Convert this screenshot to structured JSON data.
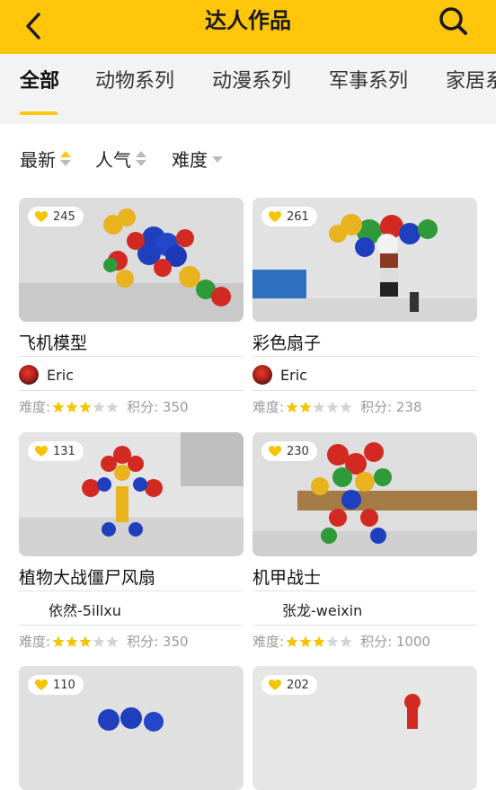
{
  "header": {
    "title": "达人作品",
    "back_icon": "back-arrow-icon",
    "search_icon": "search-icon",
    "bg_color": "#FFC60B"
  },
  "tabs": [
    {
      "label": "全部",
      "active": true
    },
    {
      "label": "动物系列",
      "active": false
    },
    {
      "label": "动漫系列",
      "active": false
    },
    {
      "label": "军事系列",
      "active": false
    },
    {
      "label": "家居系",
      "active": false
    }
  ],
  "sorts": [
    {
      "label": "最新",
      "active": true
    },
    {
      "label": "人气",
      "active": false
    },
    {
      "label": "难度",
      "active": false
    }
  ],
  "labels": {
    "difficulty": "难度:",
    "points": "积分:"
  },
  "colors": {
    "accent": "#FFC60B",
    "star_on": "#F5C400",
    "star_off": "#d4d4d4"
  },
  "cards": [
    {
      "likes": "245",
      "name": "飞机模型",
      "author": "Eric",
      "has_avatar": true,
      "difficulty": 3,
      "points": "350"
    },
    {
      "likes": "261",
      "name": "彩色扇子",
      "author": "Eric",
      "has_avatar": true,
      "difficulty": 2,
      "points": "238"
    },
    {
      "likes": "131",
      "name": "植物大战僵尸风扇",
      "author": "依然-5illxu",
      "has_avatar": false,
      "difficulty": 3,
      "points": "350"
    },
    {
      "likes": "230",
      "name": "机甲战士",
      "author": "张龙-weixin",
      "has_avatar": false,
      "difficulty": 3,
      "points": "1000"
    },
    {
      "likes": "110"
    },
    {
      "likes": "202"
    }
  ]
}
